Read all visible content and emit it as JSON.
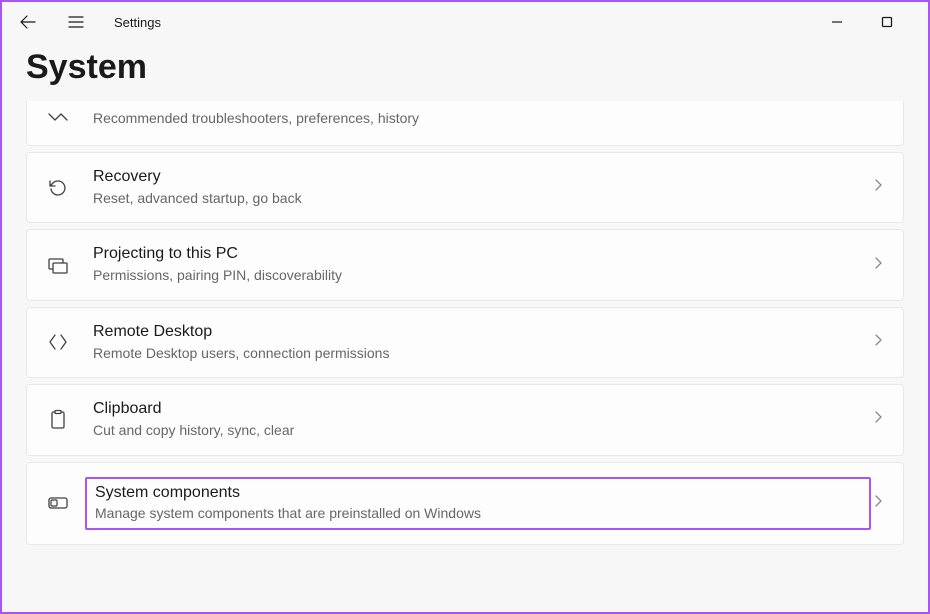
{
  "app_title": "Settings",
  "page_title": "System",
  "items": [
    {
      "title": "",
      "desc": "Recommended troubleshooters, preferences, history"
    },
    {
      "title": "Recovery",
      "desc": "Reset, advanced startup, go back"
    },
    {
      "title": "Projecting to this PC",
      "desc": "Permissions, pairing PIN, discoverability"
    },
    {
      "title": "Remote Desktop",
      "desc": "Remote Desktop users, connection permissions"
    },
    {
      "title": "Clipboard",
      "desc": "Cut and copy history, sync, clear"
    },
    {
      "title": "System components",
      "desc": "Manage system components that are preinstalled on Windows"
    }
  ]
}
